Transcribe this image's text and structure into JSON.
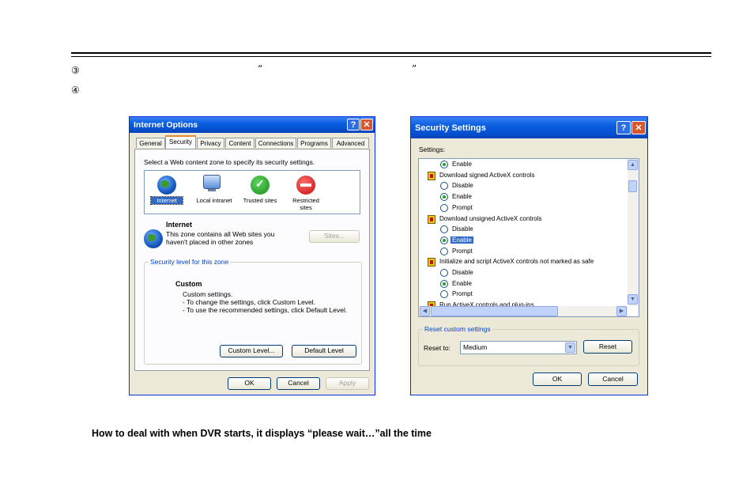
{
  "doc": {
    "step3_num": "③",
    "step3_open_quote": "“",
    "step3_close_quote": "”",
    "step4_num": "④",
    "heading": "How to deal with when DVR starts, it displays “please wait…”all the time"
  },
  "internet_options": {
    "title": "Internet Options",
    "tabs": [
      "General",
      "Security",
      "Privacy",
      "Content",
      "Connections",
      "Programs",
      "Advanced"
    ],
    "instruction": "Select a Web content zone to specify its security settings.",
    "zones": [
      {
        "label": "Internet",
        "icon": "globe-icon"
      },
      {
        "label": "Local intranet",
        "icon": "computer-icon"
      },
      {
        "label": "Trusted sites",
        "icon": "check-icon"
      },
      {
        "label": "Restricted sites",
        "icon": "restricted-icon"
      }
    ],
    "zone_name": "Internet",
    "zone_desc_1": "This zone contains all Web sites you",
    "zone_desc_2": "haven't placed in other zones",
    "sites_button": "Sites...",
    "security_level_label": "Security level for this zone",
    "level_name": "Custom",
    "level_line_1": "Custom settings.",
    "level_line_2": "- To change the settings, click Custom Level.",
    "level_line_3": "- To use the recommended settings, click Default Level.",
    "custom_level_button": "Custom Level...",
    "default_level_button": "Default Level",
    "ok_button": "OK",
    "cancel_button": "Cancel",
    "apply_button": "Apply"
  },
  "security_settings": {
    "title": "Security Settings",
    "settings_label": "Settings:",
    "rows": [
      {
        "type": "radio",
        "label": "Enable",
        "checked": true
      },
      {
        "type": "header",
        "label": "Download signed ActiveX controls"
      },
      {
        "type": "radio",
        "label": "Disable",
        "checked": false
      },
      {
        "type": "radio",
        "label": "Enable",
        "checked": true
      },
      {
        "type": "radio",
        "label": "Prompt",
        "checked": false
      },
      {
        "type": "header",
        "label": "Download unsigned ActiveX controls"
      },
      {
        "type": "radio",
        "label": "Disable",
        "checked": false
      },
      {
        "type": "radio",
        "label": "Enable",
        "checked": true,
        "selected": true
      },
      {
        "type": "radio",
        "label": "Prompt",
        "checked": false
      },
      {
        "type": "header",
        "label": "Initialize and script ActiveX controls not marked as safe"
      },
      {
        "type": "radio",
        "label": "Disable",
        "checked": false
      },
      {
        "type": "radio",
        "label": "Enable",
        "checked": true
      },
      {
        "type": "radio",
        "label": "Prompt",
        "checked": false
      },
      {
        "type": "header",
        "label": "Run ActiveX controls and plug-ins"
      }
    ],
    "reset_group_label": "Reset custom settings",
    "reset_to_label": "Reset to:",
    "reset_to_value": "Medium",
    "reset_button": "Reset",
    "ok_button": "OK",
    "cancel_button": "Cancel"
  }
}
